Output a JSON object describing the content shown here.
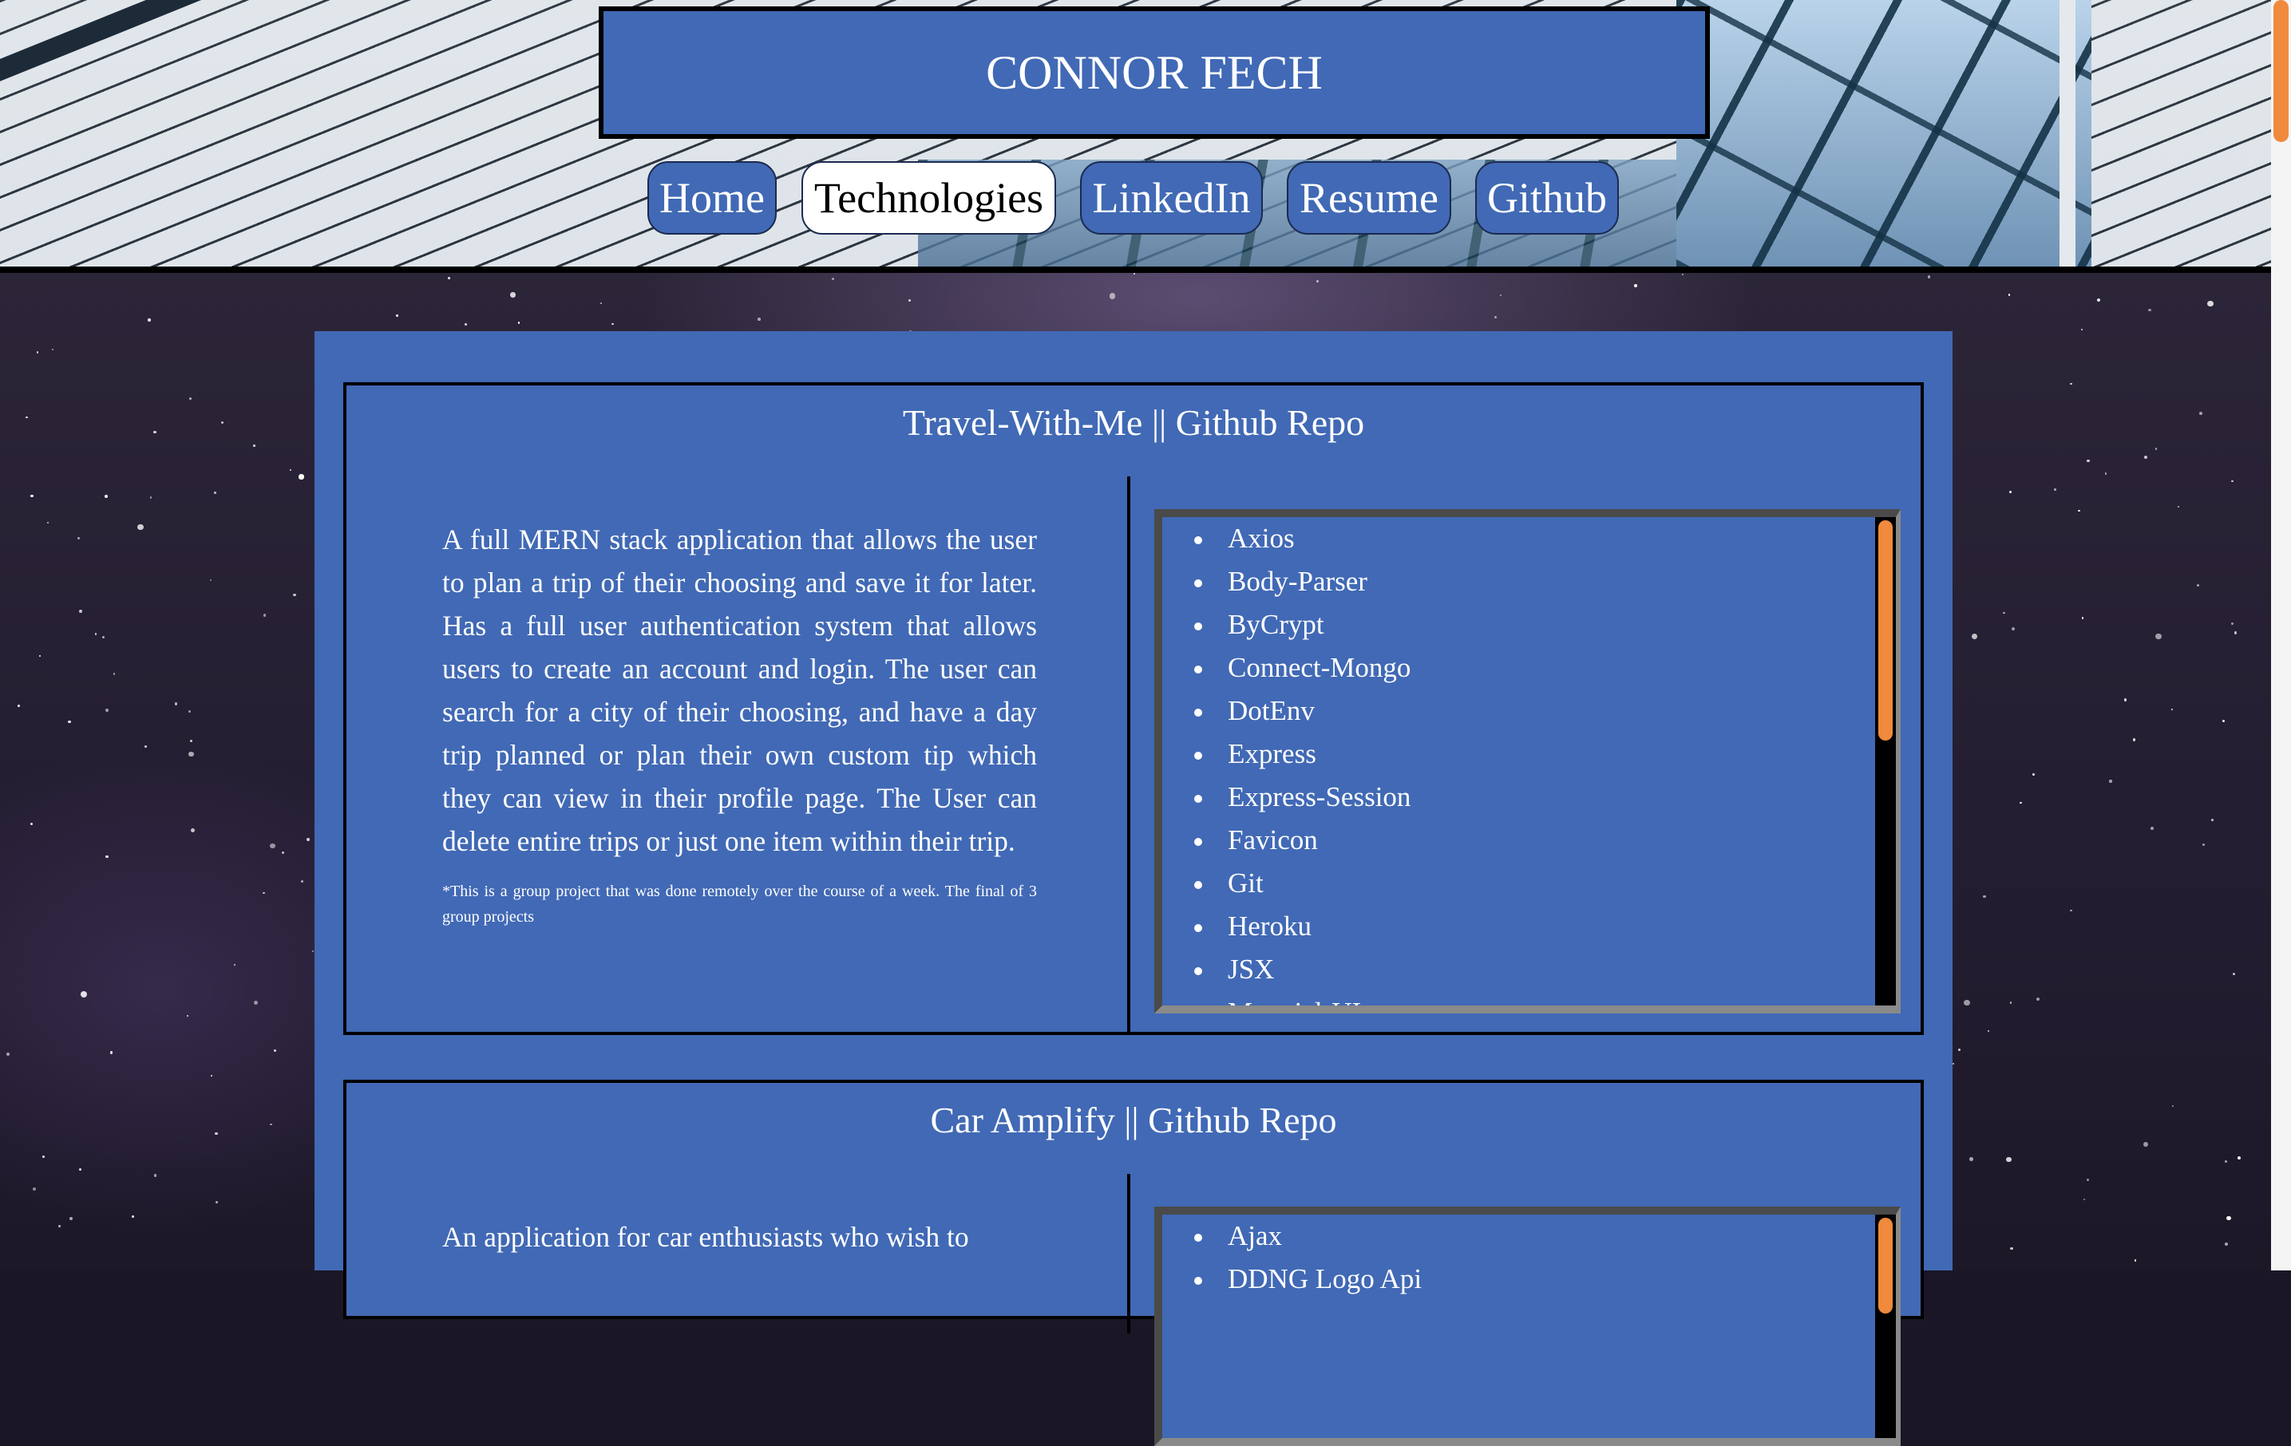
{
  "header": {
    "title": "CONNOR FECH",
    "nav": [
      {
        "label": "Home",
        "active": false
      },
      {
        "label": "Technologies",
        "active": true
      },
      {
        "label": "LinkedIn",
        "active": false
      },
      {
        "label": "Resume",
        "active": false
      },
      {
        "label": "Github",
        "active": false
      }
    ]
  },
  "projects": [
    {
      "title": "Travel-With-Me || Github Repo",
      "description": "A full MERN stack application that allows the user to plan a trip of their choosing and save it for later. Has a full user authentication system that allows users to create an account and login. The user can search for a city of their choosing, and have a day trip planned or plan their own custom tip which they can view in their profile page. The User can delete entire trips or just one item within their trip.",
      "note": "*This is a group project that was done remotely over the course of a week. The final of 3 group projects",
      "technologies": [
        "Axios",
        "Body-Parser",
        "ByCrypt",
        "Connect-Mongo",
        "DotEnv",
        "Express",
        "Express-Session",
        "Favicon",
        "Git",
        "Heroku",
        "JSX",
        "Material-UI"
      ]
    },
    {
      "title": "Car Amplify || Github Repo",
      "description": "An application for car enthusiasts who wish to",
      "technologies": [
        "Ajax",
        "DDNG Logo Api"
      ]
    }
  ],
  "colors": {
    "panel": "#4169b5",
    "accent_scroll": "#f08a3c",
    "active_nav": "#ffffff"
  }
}
